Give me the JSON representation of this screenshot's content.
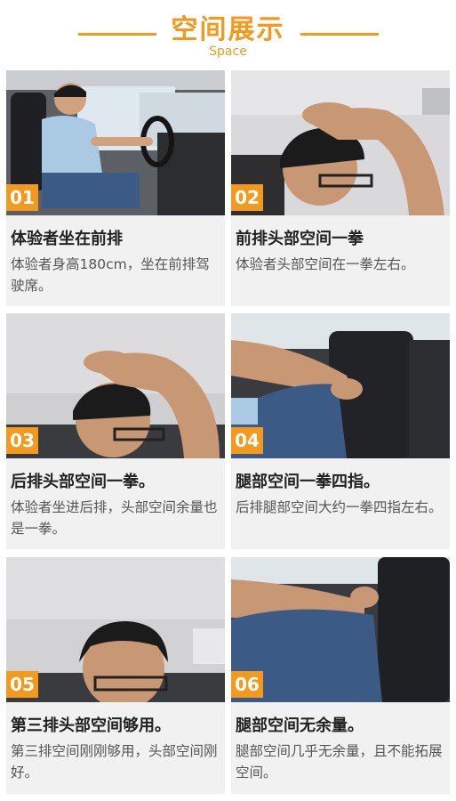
{
  "header": {
    "title": "空间展示",
    "subtitle": "Space"
  },
  "panels": [
    {
      "number": "01",
      "caption": "体验者坐在前排",
      "description": "体验者身高180cm，坐在前排驾驶席。"
    },
    {
      "number": "02",
      "caption": "前排头部空间一拳",
      "description": "体验者头部空间在一拳左右。"
    },
    {
      "number": "03",
      "caption": "后排头部空间一拳。",
      "description": "体验者坐进后排，头部空间余量也是一拳。"
    },
    {
      "number": "04",
      "caption": "腿部空间一拳四指。",
      "description": "后排腿部空间大约一拳四指左右。"
    },
    {
      "number": "05",
      "caption": "第三排头部空间够用。",
      "description": "第三排空间刚刚够用，头部空间刚好。"
    },
    {
      "number": "06",
      "caption": "腿部空间无余量。",
      "description": "腿部空间几乎无余量，且不能拓展空间。"
    }
  ],
  "colors": {
    "accent": "#f39a1e",
    "panel_bg": "#f1f1f1"
  }
}
